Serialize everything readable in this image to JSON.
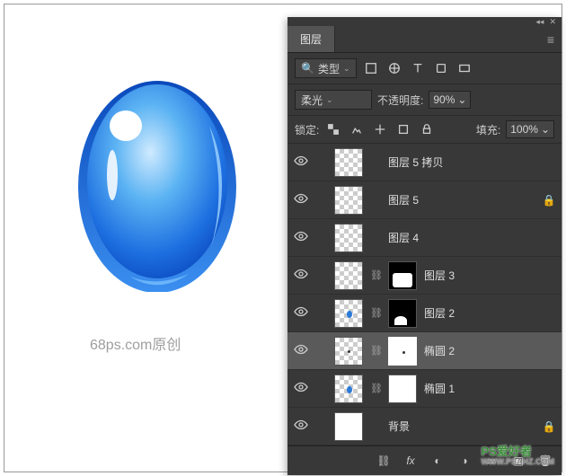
{
  "panel": {
    "title": "图层",
    "filter": {
      "kind_label": "类型",
      "search_icon": "search"
    },
    "blend": {
      "mode": "柔光",
      "opacity_label": "不透明度:",
      "opacity_value": "90%"
    },
    "lock": {
      "label": "锁定:",
      "fill_label": "填充:",
      "fill_value": "100%"
    },
    "layers": [
      {
        "name": "图层 5 拷贝",
        "thumb": "checker",
        "locked": false,
        "link": false,
        "mask": null,
        "selected": false
      },
      {
        "name": "图层 5",
        "thumb": "checker",
        "locked": true,
        "link": false,
        "mask": null,
        "selected": false
      },
      {
        "name": "图层 4",
        "thumb": "checker",
        "locked": false,
        "link": false,
        "mask": null,
        "selected": false
      },
      {
        "name": "图层 3",
        "thumb": "checker",
        "locked": false,
        "link": true,
        "mask": "m3",
        "selected": false
      },
      {
        "name": "图层 2",
        "thumb": "checker-dot",
        "locked": false,
        "link": true,
        "mask": "m2",
        "selected": false
      },
      {
        "name": "椭圆 2",
        "thumb": "checker-dotsm",
        "locked": false,
        "link": true,
        "mask": "white-sel",
        "selected": true
      },
      {
        "name": "椭圆 1",
        "thumb": "checker-dot",
        "locked": false,
        "link": true,
        "mask": "white",
        "selected": false
      },
      {
        "name": "背景",
        "thumb": "white",
        "locked": true,
        "link": false,
        "mask": null,
        "selected": false
      }
    ]
  },
  "watermark": {
    "text": "68ps.com原创",
    "logo_main": "PS爱好者",
    "logo_sub": "WWW.PSAHZ.COM"
  }
}
